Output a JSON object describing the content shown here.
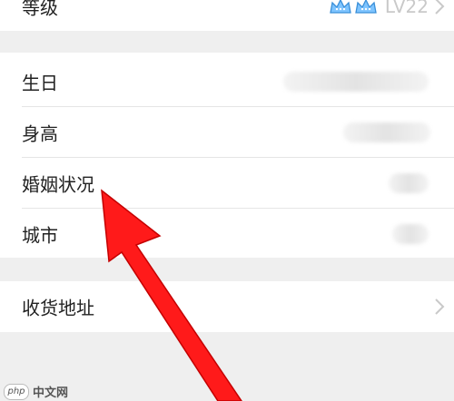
{
  "level": {
    "label": "等级",
    "value": "LV22",
    "icons": [
      "crown-icon",
      "crown-icon"
    ],
    "crown_color": "#7ec4ff"
  },
  "profile": {
    "items": [
      {
        "label": "生日"
      },
      {
        "label": "身高"
      },
      {
        "label": "婚姻状况"
      },
      {
        "label": "城市"
      }
    ]
  },
  "address": {
    "label": "收货地址"
  },
  "annotation": {
    "arrow_color": "#ff1a1a"
  },
  "watermark": {
    "badge": "php",
    "text": "中文网"
  },
  "colors": {
    "page_bg": "#efefef",
    "row_bg": "#ffffff",
    "divider": "#e5e5e5"
  }
}
